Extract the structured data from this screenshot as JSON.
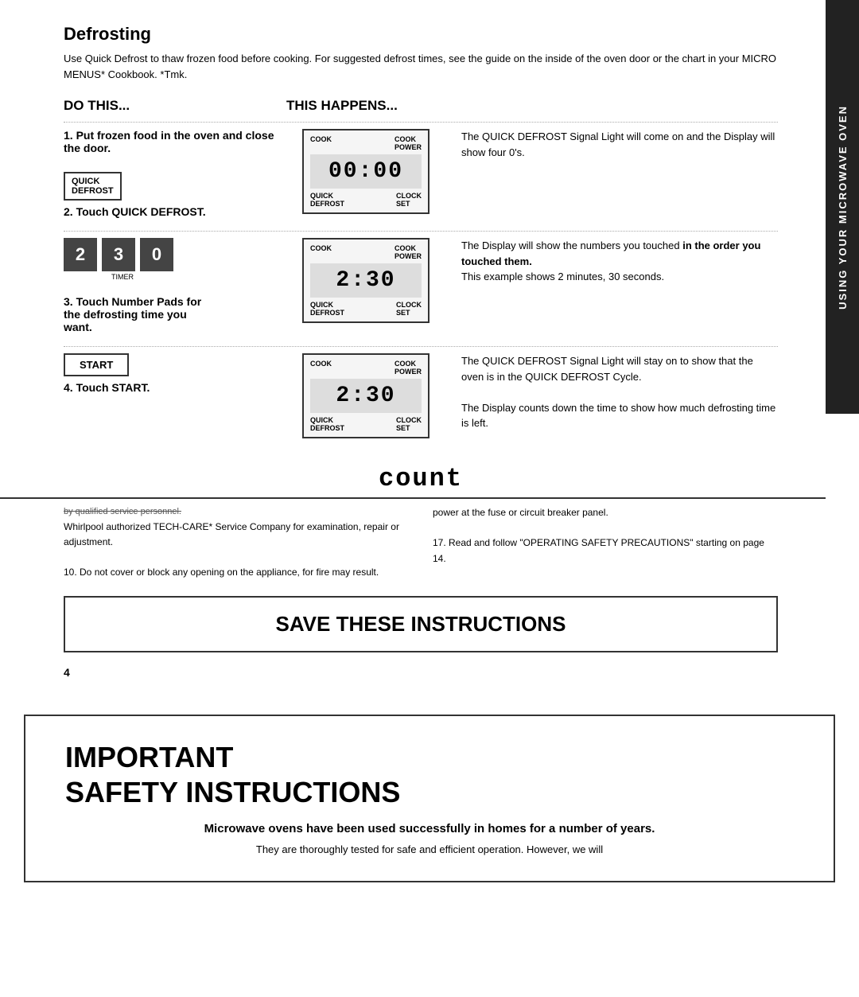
{
  "page": {
    "side_tab": "USING YOUR MICROWAVE OVEN",
    "section": {
      "title": "Defrosting",
      "intro": "Use Quick Defrost to thaw frozen food before cooking. For suggested defrost times, see the guide on the inside of the oven door or the chart in your MICRO MENUS* Cookbook.",
      "tmk": "*Tmk.",
      "col_do_this": "DO THIS...",
      "col_this_happens": "THIS HAPPENS..."
    },
    "steps": [
      {
        "number": "1.",
        "desc": "Put frozen food in the oven and close the door.",
        "display": "00:00",
        "display_top_left": "COOK",
        "display_top_right": "COOK POWER",
        "display_bottom_left": "QUICK DEFROST",
        "display_bottom_right": "CLOCK SET",
        "right_text": "The QUICK DEFROST Signal Light will come on and the Display will show four 0's.",
        "has_qd_button": true,
        "step_label": "2. Touch QUICK DEFROST."
      },
      {
        "number": "3.",
        "desc": "Touch Number Pads for the defrosting time you want.",
        "keys": [
          "2",
          "3",
          "0"
        ],
        "key_sub": "TIMER",
        "display": "2:30",
        "display_top_left": "COOK",
        "display_top_right": "COOK POWER",
        "display_bottom_left": "QUICK DEFROST",
        "display_bottom_right": "CLOCK SET",
        "right_text_1": "The Display will show the numbers you touched ",
        "right_bold": "in the order you touched them.",
        "right_text_2": "This example shows 2 minutes, 30 seconds."
      },
      {
        "number": "4.",
        "desc": "Touch START.",
        "display": "2:30",
        "display_top_left": "COOK",
        "display_top_right": "COOK POWER",
        "display_bottom_left": "QUICK DEFROST",
        "display_bottom_right": "CLOCK SET",
        "right_text_1": "The QUICK DEFROST Signal Light will stay on to show that the oven is in the QUICK DEFROST Cycle.",
        "right_text_2": "The Display counts down the time to show how much defrosting time is left.",
        "has_start_button": true
      }
    ],
    "count_heading": "count",
    "bottom": {
      "left_text_1": "by qualified service personnel.",
      "left_text_2": "Whirlpool authorized TECH-CARE* Service Company for examination, repair or adjustment.",
      "left_text_3": "10. Do not cover or block any opening on the appliance, for fire may result.",
      "right_text_1": "power at the fuse or circuit breaker panel.",
      "right_text_2": "17. Read and follow \"OPERATING SAFETY PRECAUTIONS\" starting on page 14."
    },
    "save_instructions": "SAVE THESE INSTRUCTIONS",
    "page_number": "4",
    "safety": {
      "title_line1": "IMPORTANT",
      "title_line2": "SAFETY INSTRUCTIONS",
      "subtitle": "Microwave ovens have been used successfully in homes for a number of years.",
      "body": "They are thoroughly tested for safe and efficient operation. However, we will"
    }
  }
}
